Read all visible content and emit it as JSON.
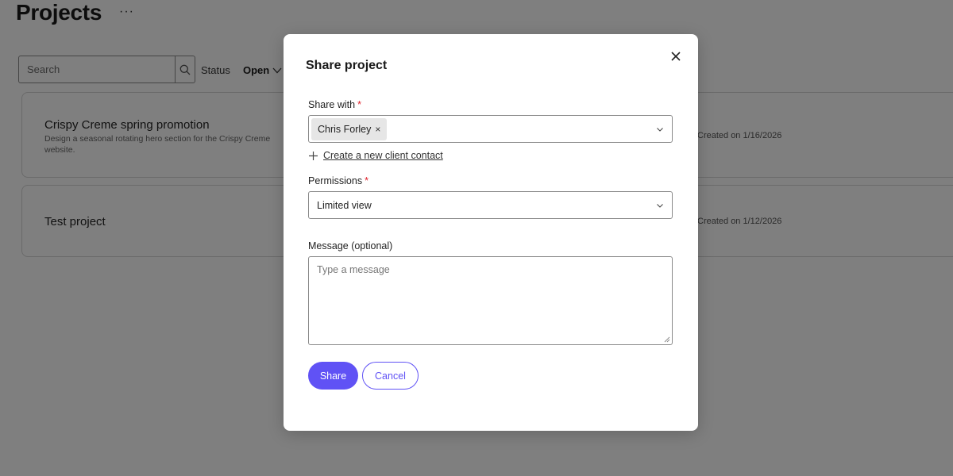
{
  "page": {
    "title": "Projects",
    "more_label": "···",
    "search_placeholder": "Search",
    "status_label": "Status",
    "status_value": "Open"
  },
  "projects": [
    {
      "name": "Crispy Creme spring promotion",
      "description": "Design a seasonal rotating hero section for the Crispy Creme website.",
      "created": "Created on 1/16/2026"
    },
    {
      "name": "Test project",
      "description": "",
      "created": "Created on 1/12/2026"
    }
  ],
  "modal": {
    "title": "Share project",
    "share_with_label": "Share with",
    "share_with_chip": "Chris Forley",
    "chip_remove": "×",
    "required_marker": "*",
    "create_contact_label": "Create a new client contact",
    "permissions_label": "Permissions",
    "permissions_value": "Limited view",
    "message_label": "Message (optional)",
    "message_placeholder": "Type a message",
    "share_button": "Share",
    "cancel_button": "Cancel"
  },
  "colors": {
    "accent": "#6052f5",
    "required": "#e0202a",
    "overlay": "rgba(0,0,0,0.5)"
  },
  "icons": [
    "more-icon",
    "search-icon",
    "chevron-down-icon",
    "close-icon",
    "plus-icon",
    "resize-grip-icon"
  ]
}
